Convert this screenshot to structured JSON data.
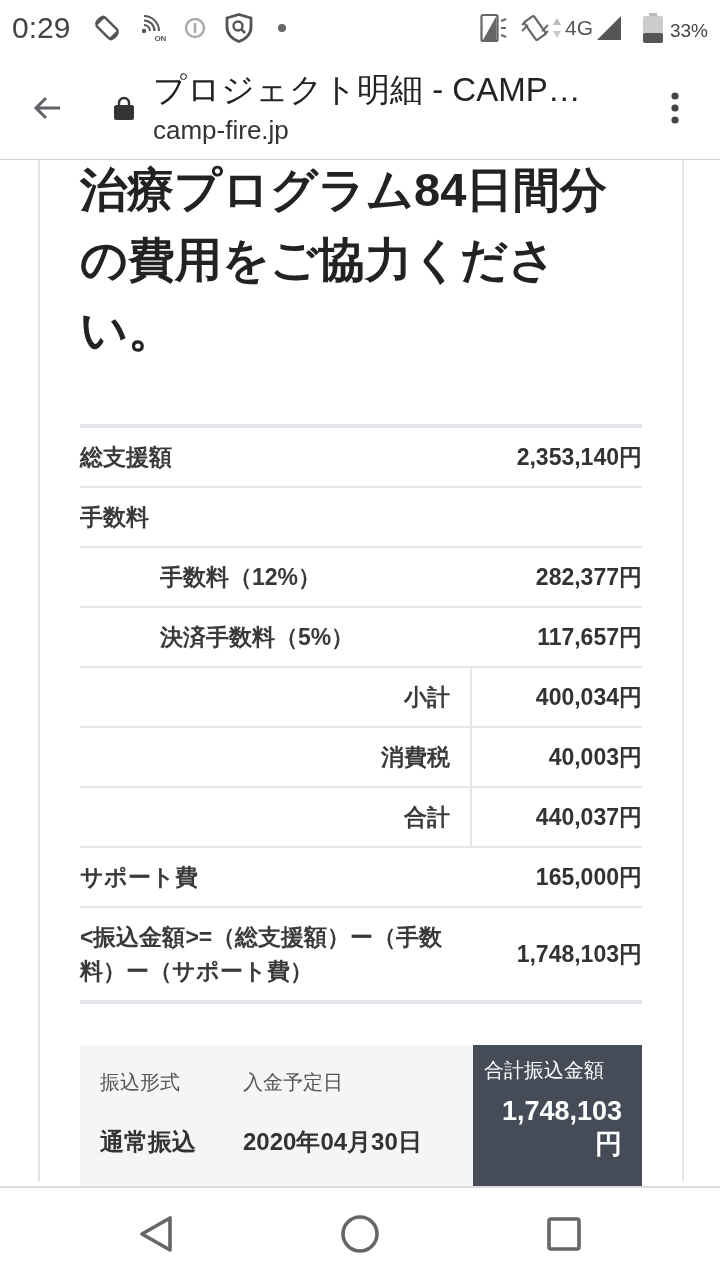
{
  "status_bar": {
    "time": "0:29",
    "wifi_call_badge": "ON",
    "network": "4G",
    "battery": "33%"
  },
  "browser": {
    "title": "プロジェクト明細 - CAMP…",
    "url": "camp-fire.jp"
  },
  "heading": "治療プログラム84日間分の費用をご協力ください。",
  "breakdown": {
    "rows": [
      {
        "kind": "main",
        "label": "総支援額",
        "value": "2,353,140円"
      },
      {
        "kind": "group",
        "label": "手数料"
      },
      {
        "kind": "sub",
        "label": "手数料（12%）",
        "value": "282,377円"
      },
      {
        "kind": "sub",
        "label": "決済手数料（5%）",
        "value": "117,657円"
      },
      {
        "kind": "total",
        "label": "小計",
        "value": "400,034円"
      },
      {
        "kind": "total",
        "label": "消費税",
        "value": "40,003円"
      },
      {
        "kind": "total",
        "label": "合計",
        "value": "440,037円"
      },
      {
        "kind": "main",
        "label": "サポート費",
        "value": "165,000円"
      },
      {
        "kind": "main",
        "label": "<振込金額>=（総支援額）ー（手数料）ー（サポート費）",
        "value": "1,748,103円"
      }
    ]
  },
  "transfer": {
    "fields": [
      {
        "label": "振込形式",
        "value": "通常振込"
      },
      {
        "label": "入金予定日",
        "value": "2020年04月30日"
      }
    ],
    "total_label": "合計振込金額",
    "total_value": "1,748,103円"
  }
}
